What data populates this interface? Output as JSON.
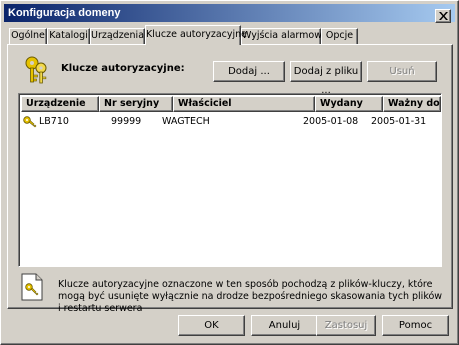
{
  "window": {
    "title": "Konfiguracja domeny"
  },
  "tabs": [
    {
      "label": "Ogólne",
      "active": false
    },
    {
      "label": "Katalogi",
      "active": false
    },
    {
      "label": "Urządzenia",
      "active": false
    },
    {
      "label": "Klucze autoryzacyjne",
      "active": true
    },
    {
      "label": "Wyjścia alarmowe",
      "active": false
    },
    {
      "label": "Opcje",
      "active": false
    }
  ],
  "keys_panel": {
    "heading": "Klucze autoryzacyjne:",
    "add_label": "Dodaj ...",
    "add_from_file_label": "Dodaj z pliku ...",
    "remove_label": "Usuń",
    "icon": "keys-icon"
  },
  "table": {
    "columns": [
      "Urządzenie",
      "Nr seryjny",
      "Właściciel",
      "Wydany",
      "Ważny do"
    ],
    "rows": [
      {
        "device": "LB710",
        "serial": "99999",
        "owner": "WAGTECH",
        "issued": "2005-01-08",
        "valid_until": "2005-01-31",
        "icon": "key-icon"
      }
    ]
  },
  "info": {
    "text": "Klucze autoryzacyjne oznaczone w ten sposób pochodzą z plików-kluczy, które mogą być usunięte wyłącznie na drodze bezpośredniego skasowania tych plików i restartu serwera",
    "icon": "key-file-icon"
  },
  "footer": {
    "ok_label": "OK",
    "cancel_label": "Anuluj",
    "apply_label": "Zastosuj",
    "help_label": "Pomoc"
  },
  "colors": {
    "face": "#d4d0c8",
    "title_start": "#0a246a",
    "title_end": "#a6caf0",
    "key": "#c8a800"
  }
}
